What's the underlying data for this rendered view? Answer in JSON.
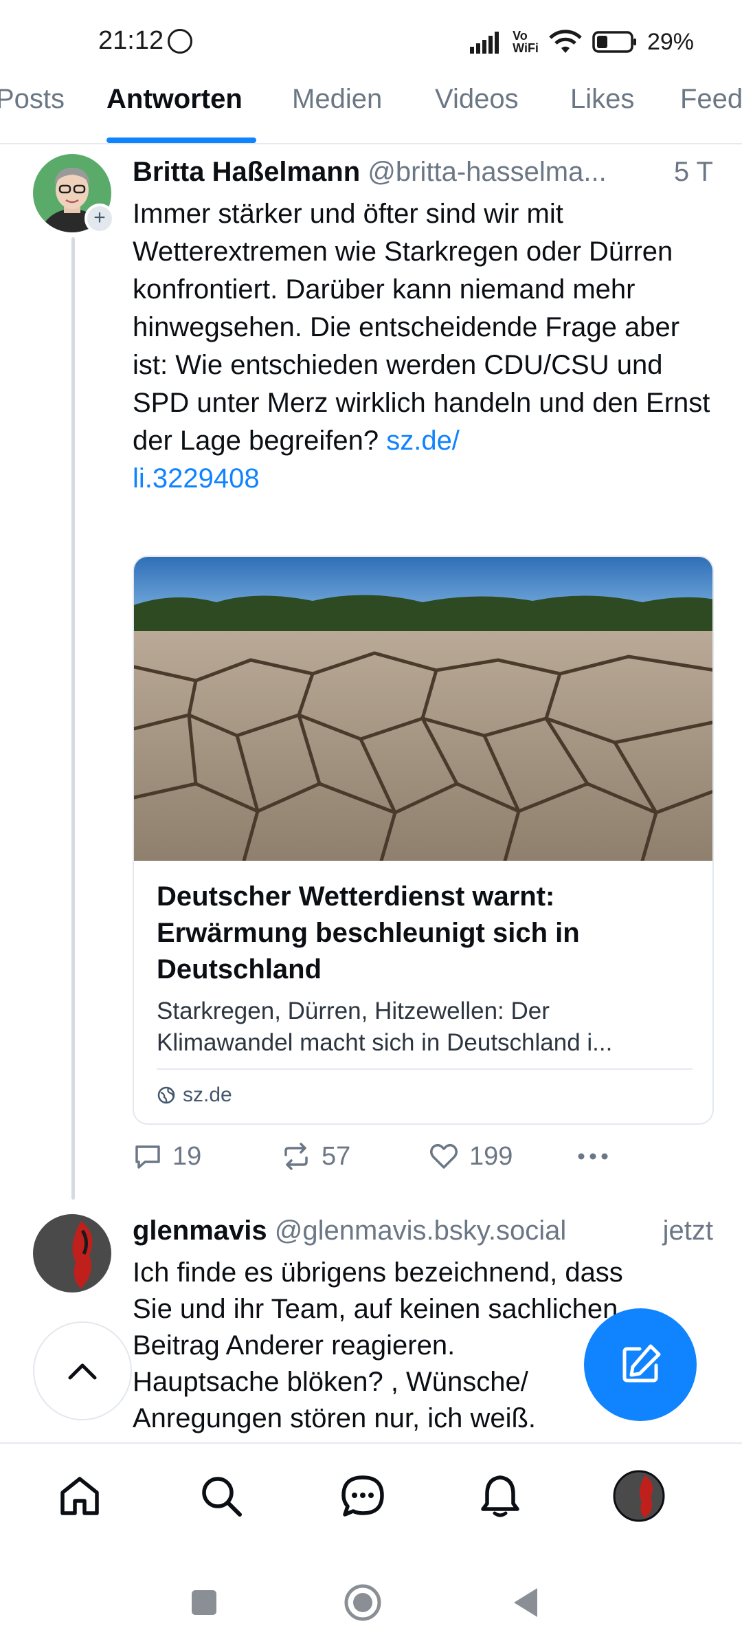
{
  "status_bar": {
    "time": "21:12",
    "volte": "Vo",
    "wifi_label": "WiFi",
    "battery": "29%",
    "icons": [
      "dnd-icon",
      "signal-icon",
      "wifi-icon",
      "battery-icon"
    ]
  },
  "tabs": [
    {
      "label": "Posts",
      "active": false
    },
    {
      "label": "Antworten",
      "active": true
    },
    {
      "label": "Medien",
      "active": false
    },
    {
      "label": "Videos",
      "active": false
    },
    {
      "label": "Likes",
      "active": false
    },
    {
      "label": "Feeds",
      "active": false
    }
  ],
  "post": {
    "author": "Britta Haßelmann",
    "handle": "@britta-hasselma...",
    "time": "5 T",
    "text": "Immer stärker und öfter sind wir mit Wetterextremen wie Starkregen oder Dürren konfrontiert. Darüber kann niemand mehr hinwegsehen. Die entscheidende Frage aber ist: Wie entschieden werden CDU/CSU und SPD unter Merz wirklich handeln und den Ernst der Lage begreifen?",
    "link_line1": "sz.de/",
    "link_line2": "li.3229408",
    "card": {
      "title": "Deutscher Wetterdienst warnt: Erwärmung beschleunigt sich in Deutschland",
      "desc_line1": "Starkregen, Dürren, Hitzewellen: Der",
      "desc_line2": "Klimawandel macht sich in Deutschland i...",
      "domain": "sz.de"
    },
    "actions": {
      "replies": "19",
      "reposts": "57",
      "likes": "199"
    }
  },
  "post2": {
    "author": "glenmavis",
    "handle": "@glenmavis.bsky.social",
    "time": "jetzt",
    "line1": "Ich finde es übrigens bezeichnend, dass",
    "line2": "Sie und ihr Team, auf keinen sachlichen",
    "line3": "Beitrag Anderer reagieren.",
    "line4": "Hauptsache blöken? , Wünsche/",
    "line5": "Anregungen stören nur, ich weiß."
  },
  "colors": {
    "accent": "#1083fe",
    "muted": "#6b7785",
    "border": "#e3e8ee"
  },
  "bottom_nav": [
    "home-icon",
    "search-icon",
    "chat-icon",
    "bell-icon",
    "profile-avatar"
  ],
  "system_nav": [
    "recents-button",
    "home-button",
    "back-button"
  ]
}
